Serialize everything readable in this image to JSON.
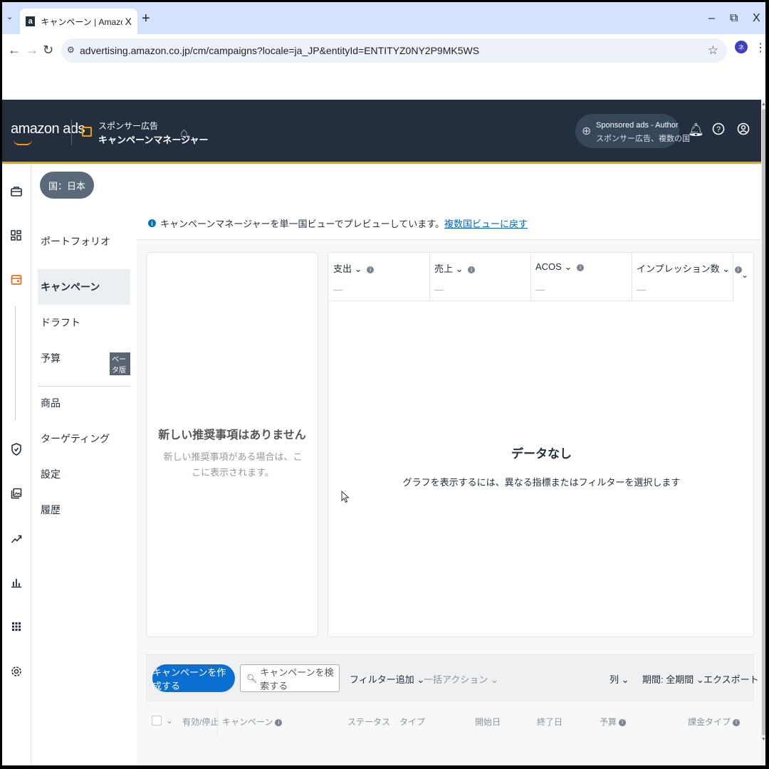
{
  "browser": {
    "tab_title": "キャンペーン | Amazon Advertising",
    "tab_favicon": "a",
    "tab_close": "X",
    "new_tab": "+",
    "url": "advertising.amazon.co.jp/cm/campaigns?locale=ja_JP&entityId=ENTITYZ0NY2P9MK5WS",
    "profile_initial": "ネ",
    "win_minimize": "–",
    "win_restore": "⧉",
    "win_close": "X"
  },
  "header": {
    "logo": "amazon ads",
    "product_sub": "スポンサー広告",
    "product_title": "キャンペーンマネージャー",
    "account_name": "Sponsored ads - Author",
    "account_desc": "スポンサー広告、複数の国"
  },
  "country_pill": "国：日本",
  "leftnav": {
    "items": [
      {
        "label": "ポートフォリオ"
      },
      {
        "label": "キャンペーン"
      },
      {
        "label": "ドラフト"
      },
      {
        "label": "予算"
      },
      {
        "label": "商品"
      },
      {
        "label": "ターゲティング"
      },
      {
        "label": "設定"
      },
      {
        "label": "履歴"
      }
    ],
    "beta_badge": "ベータ版"
  },
  "info_bar": {
    "text": "キャンペーンマネージャーを単一国ビューでプレビューしています。",
    "link": "複数国ビューに戻す"
  },
  "recommendations": {
    "title": "新しい推奨事項はありません",
    "desc": "新しい推奨事項がある場合は、ここに表示されます。"
  },
  "metrics": [
    {
      "label": "支出",
      "value": "—"
    },
    {
      "label": "売上",
      "value": "—"
    },
    {
      "label": "ACOS",
      "value": "—"
    },
    {
      "label": "インプレッション数",
      "value": "—"
    }
  ],
  "chart": {
    "nodata_title": "データなし",
    "nodata_desc": "グラフを表示するには、異なる指標またはフィルターを選択します"
  },
  "toolbar": {
    "create": "キャンペーンを作成する",
    "search_placeholder": "キャンペーンを検索する",
    "filter": "フィルター追加",
    "bulk": "一括アクション",
    "columns": "列",
    "period": "期間: 全期間",
    "export": "エクスポート"
  },
  "table_headers": {
    "active": "有効/停止",
    "campaign": "キャンペーン",
    "status": "ステータス",
    "type": "タイプ",
    "start": "開始日",
    "end": "終了日",
    "budget": "予算",
    "billing": "課金タイプ"
  },
  "colors": {
    "header_bg": "#232f3e",
    "accent": "#ff9900",
    "primary_button": "#0a6fd1"
  }
}
